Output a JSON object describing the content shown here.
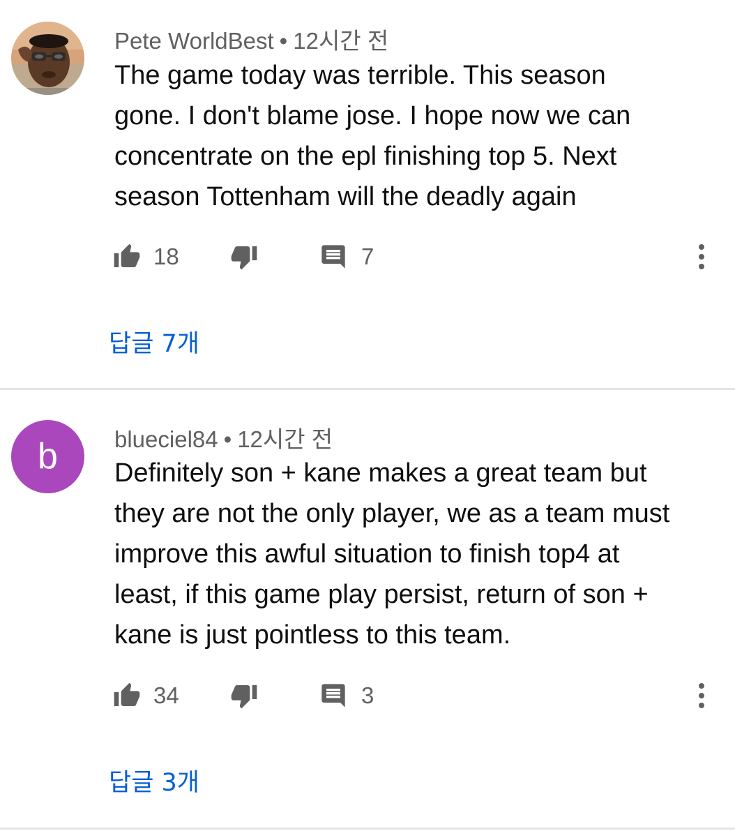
{
  "comments": [
    {
      "author": "Pete WorldBest",
      "separator": "•",
      "time": "12시간 전",
      "text": "The game today was terrible. This season\ngone. I don't blame jose. I hope now we can\nconcentrate on the epl finishing top 5. Next\nseason Tottenham will the deadly again",
      "likes": "18",
      "reply_count": "7",
      "replies_label": "답글 7개",
      "avatar": {
        "type": "photo",
        "bg": "#c98a5a"
      }
    },
    {
      "author": "blueciel84",
      "separator": "•",
      "time": "12시간 전",
      "text": "Definitely son + kane makes a great team but\nthey are not the only player, we as a team must\nimprove this awful situation to finish top4 at\nleast, if this game play persist, return of son +\nkane is just pointless to this team.",
      "likes": "34",
      "reply_count": "3",
      "replies_label": "답글 3개",
      "avatar": {
        "type": "letter",
        "letter": "b",
        "bg": "#ab47bc"
      }
    }
  ],
  "icons": {
    "like": "thumb-up-icon",
    "dislike": "thumb-down-icon",
    "reply": "comment-icon",
    "more": "more-vert-icon"
  },
  "colors": {
    "link": "#065fd4",
    "meta": "#606060",
    "icon": "#606060",
    "divider": "#e5e5e5"
  }
}
